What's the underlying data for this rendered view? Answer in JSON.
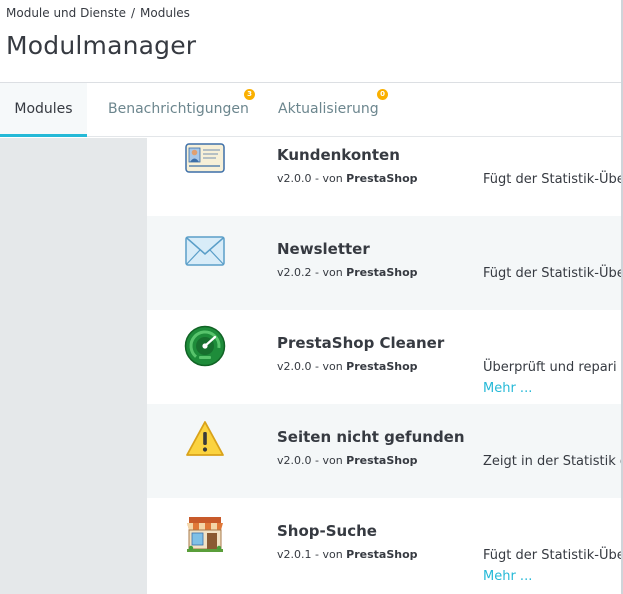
{
  "breadcrumb": {
    "items": [
      "Module und Dienste",
      "Modules"
    ],
    "separator": "/"
  },
  "page": {
    "title": "Modulmanager"
  },
  "tabs": [
    {
      "label": "Modules",
      "active": true,
      "badge": null
    },
    {
      "label": "Benachrichtigungen",
      "active": false,
      "badge": "3"
    },
    {
      "label": "Aktualisierung",
      "active": false,
      "badge": "0"
    }
  ],
  "modules": [
    {
      "name": "Kundenkonten",
      "version": "v2.0.0 - von ",
      "author": "PrestaShop",
      "description": "Fügt der Statistik-Übe",
      "more": "",
      "icon": "customer-card-icon"
    },
    {
      "name": "Newsletter",
      "version": "v2.0.2 - von ",
      "author": "PrestaShop",
      "description": "Fügt der Statistik-Übe",
      "more": "",
      "icon": "envelope-icon"
    },
    {
      "name": "PrestaShop Cleaner",
      "version": "v2.0.0 - von ",
      "author": "PrestaShop",
      "description": "Überprüft und repari",
      "more": "Mehr ...",
      "icon": "gauge-icon"
    },
    {
      "name": "Seiten nicht gefunden",
      "version": "v2.0.0 - von ",
      "author": "PrestaShop",
      "description": "Zeigt in der Statistik d",
      "more": "",
      "icon": "warning-icon"
    },
    {
      "name": "Shop-Suche",
      "version": "v2.0.1 - von ",
      "author": "PrestaShop",
      "description": "Fügt der Statistik-Übe",
      "more": "Mehr ...",
      "icon": "storefront-icon"
    }
  ],
  "colors": {
    "accent": "#25b9d7",
    "badge": "#fab000",
    "text": "#363a41",
    "muted": "#6c868e"
  }
}
